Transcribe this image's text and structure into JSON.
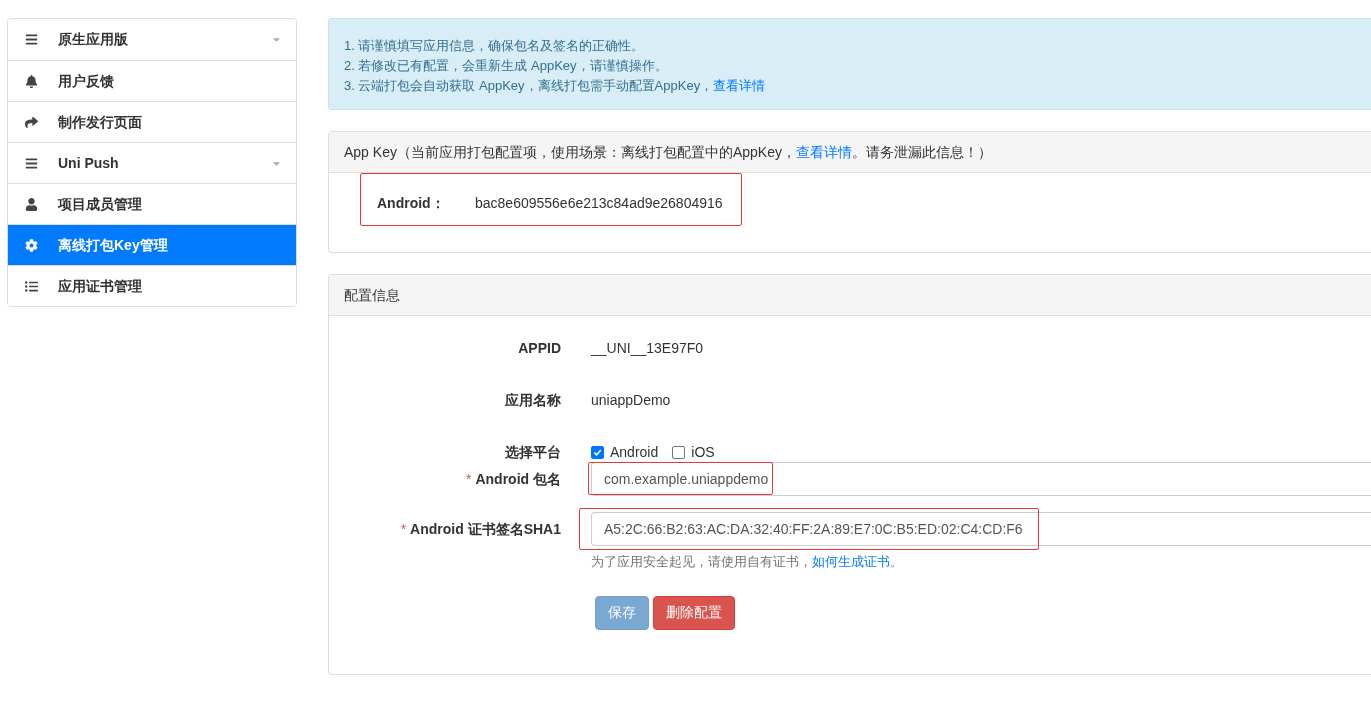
{
  "sidebar": {
    "items": [
      {
        "label": "原生应用版",
        "dropdown": true,
        "selected": false
      },
      {
        "label": "用户反馈",
        "dropdown": false,
        "selected": false
      },
      {
        "label": "制作发行页面",
        "dropdown": false,
        "selected": false
      },
      {
        "label": "Uni Push",
        "dropdown": true,
        "selected": false
      },
      {
        "label": "项目成员管理",
        "dropdown": false,
        "selected": false
      },
      {
        "label": "离线打包Key管理",
        "dropdown": false,
        "selected": true
      },
      {
        "label": "应用证书管理",
        "dropdown": false,
        "selected": false
      }
    ]
  },
  "notice": {
    "lines": [
      {
        "text": "1. 请谨慎填写应用信息，确保包名及签名的正确性。"
      },
      {
        "text": "2. 若修改已有配置，会重新生成 AppKey，请谨慎操作。"
      },
      {
        "text": "3. 云端打包会自动获取 AppKey，离线打包需手动配置AppKey，",
        "link": "查看详情"
      }
    ]
  },
  "appkey_panel": {
    "title_before": "App Key（当前应用打包配置项，使用场景：离线打包配置中的AppKey，",
    "title_link": "查看详情",
    "title_after": "。请务泄漏此信息！）",
    "label": "Android：",
    "value": "bac8e609556e6e213c84ad9e26804916"
  },
  "config_panel": {
    "title": "配置信息",
    "appid": {
      "label": "APPID",
      "value": "__UNI__13E97F0"
    },
    "app_name": {
      "label": "应用名称",
      "value": "uniappDemo"
    },
    "platform": {
      "label": "选择平台",
      "options": [
        {
          "label": "Android",
          "checked": true
        },
        {
          "label": "iOS",
          "checked": false
        }
      ]
    },
    "package": {
      "required_mark": "*",
      "label": "Android 包名",
      "value": "com.example.uniappdemo"
    },
    "sha1": {
      "required_mark": "*",
      "label": "Android 证书签名SHA1",
      "value": "A5:2C:66:B2:63:AC:DA:32:40:FF:2A:89:E7:0C:B5:ED:02:C4:CD:F6"
    },
    "help": {
      "before": "为了应用安全起见，请使用自有证书，",
      "link": "如何生成证书",
      "after": "。"
    },
    "buttons": [
      {
        "label": "保存",
        "kind": "primary",
        "disabled": true
      },
      {
        "label": "删除配置",
        "kind": "danger",
        "disabled": false
      }
    ]
  }
}
